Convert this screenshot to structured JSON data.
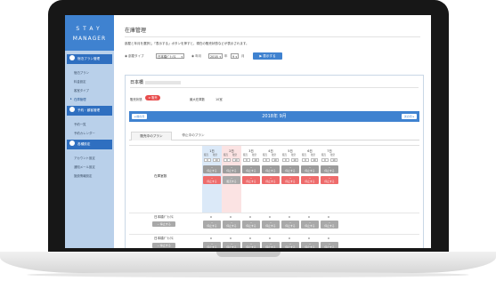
{
  "sidebar": {
    "brand_top": "STAY",
    "brand_bottom": "MANAGER",
    "sections": [
      {
        "title": "宿泊プラン管理",
        "items": [
          "宿泊プラン",
          "料金設定",
          "客室タイプ",
          "在庫管理"
        ]
      },
      {
        "title": "予約・顧客管理",
        "items": [
          "予約一覧",
          "予約カレンダー"
        ]
      },
      {
        "title": "各種設定",
        "items": [
          "アカウント設定",
          "通知メール設定",
          "施設情報設定"
        ]
      }
    ]
  },
  "page": {
    "title": "在庫管理",
    "description": "部屋と年月を選択し「表示する」ボタンを押すと、現在の販売状態などが表示されます。",
    "filter": {
      "room_type_label": "部屋タイプ",
      "room_type_value": "日本橋ﾃﾞﾗｯｸｽ",
      "year_month_label": "年月",
      "year_value": "2018",
      "year_unit": "年",
      "month_value": "9",
      "month_unit": "月",
      "show_button": "表示する"
    }
  },
  "card": {
    "hotel_name": "日本橋",
    "status_label": "販売状態",
    "status_badge": "販売",
    "max_stock_label": "最大在庫数",
    "max_stock_value": "10室",
    "calendar_title": "2018年 9月",
    "prev_label": "前の月",
    "next_label": "次の月",
    "tabs": [
      "販売中のプラン",
      "停止中のプラン"
    ],
    "rows": [
      {
        "label": "在庫室数"
      },
      {
        "label": "日本橋ﾃﾞﾗｯｸｽ",
        "stop_button": "停止する"
      },
      {
        "label": "日本橋ﾃﾞﾗｯｸｽ",
        "stop_button": "停止する"
      }
    ],
    "days": [
      {
        "date": "1日",
        "sold_label": "販売",
        "stock_label": "残室",
        "sold": "0",
        "stock": "10",
        "state": "selling",
        "button": "停止する"
      },
      {
        "date": "2日",
        "sold_label": "販売",
        "stock_label": "残室",
        "sold": "0",
        "stock": "10",
        "state": "stopped",
        "button": "販売する"
      },
      {
        "date": "3日",
        "sold_label": "販売",
        "stock_label": "残室",
        "sold": "0",
        "stock": "10",
        "state": "selling",
        "button": "停止する"
      },
      {
        "date": "4日",
        "sold_label": "販売",
        "stock_label": "残室",
        "sold": "0",
        "stock": "10",
        "state": "selling",
        "button": "停止する"
      },
      {
        "date": "5日",
        "sold_label": "販売",
        "stock_label": "残室",
        "sold": "0",
        "stock": "10",
        "state": "selling",
        "button": "停止する"
      },
      {
        "date": "6日",
        "sold_label": "販売",
        "stock_label": "残室",
        "sold": "0",
        "stock": "10",
        "state": "selling",
        "button": "停止する"
      },
      {
        "date": "7日",
        "sold_label": "販売",
        "stock_label": "残室",
        "sold": "0",
        "stock": "10",
        "state": "selling",
        "button": "停止する"
      }
    ],
    "plan_cell_value": "0",
    "plan_cell_button": "停止する",
    "minus_sign": "−"
  },
  "colors": {
    "accent": "#3f82d0",
    "sidebar_bg": "#b9d0ea",
    "danger": "#e84b4b",
    "stopped_bg": "#fbe3e3",
    "selected_bg": "#dbe9f8"
  }
}
